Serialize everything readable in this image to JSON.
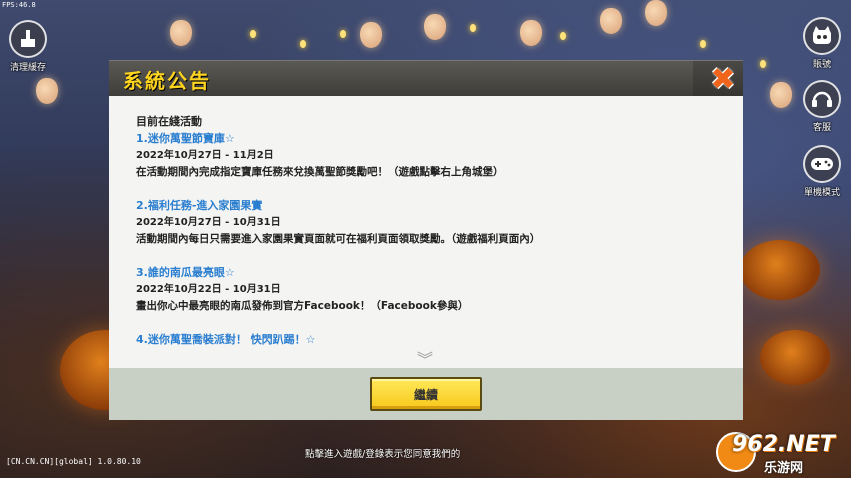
{
  "fps": "FPS:46.8",
  "side_buttons": {
    "clear_cache": "清理緩存",
    "account": "賬號",
    "service": "客服",
    "single_mode": "單機模式"
  },
  "dialog": {
    "title": "系統公告",
    "section_heading": "目前在綫活動",
    "events": [
      {
        "title": "1.迷你萬聖節寶庫☆",
        "date": "2022年10月27日 - 11月2日",
        "desc": "在活動期間內完成指定寶庫任務來兌換萬聖節獎勵吧！（遊戲點擊右上角城堡）"
      },
      {
        "title": "2.福利任務-進入家園果實",
        "date": "2022年10月27日 - 10月31日",
        "desc": "活動期間內每日只需要進入家園果實頁面就可在福利頁面領取獎勵。（遊戲福利頁面內）"
      },
      {
        "title": "3.誰的南瓜最亮眼☆",
        "date": "2022年10月22日 - 10月31日",
        "desc": "畫出你心中最亮眼的南瓜發佈到官方Facebook！（Facebook參與）"
      },
      {
        "title": "4.迷你萬聖喬裝派對！ 快閃趴踢！☆"
      }
    ],
    "continue_label": "繼續"
  },
  "footer": {
    "version": "[CN.CN.CN][global] 1.0.80.10",
    "notice": "點擊進入遊戲/登錄表示您同意我們的"
  },
  "watermark": {
    "brand": "962.NET",
    "sub": "乐游网"
  },
  "colors": {
    "title": "#ffd41f",
    "link": "#2a7ed0",
    "close": "#f0651b",
    "button": "#f7c81a"
  }
}
